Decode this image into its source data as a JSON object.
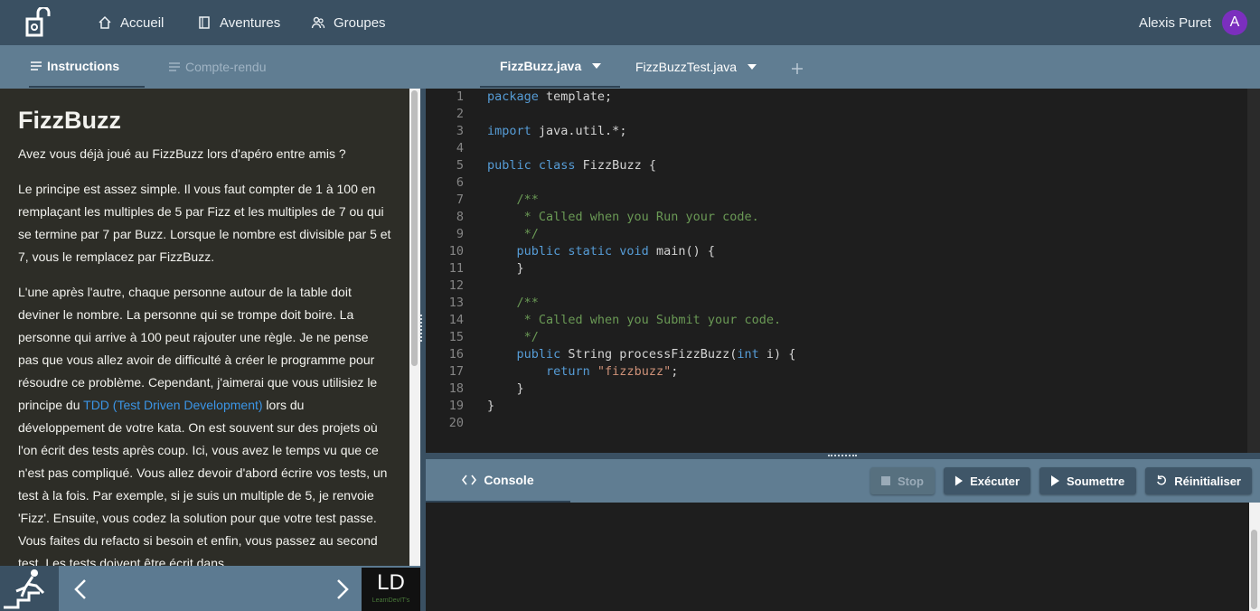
{
  "nav": {
    "home": "Accueil",
    "adventures": "Aventures",
    "groups": "Groupes"
  },
  "user": {
    "name": "Alexis Puret",
    "initial": "A"
  },
  "left_tabs": {
    "instructions": "Instructions",
    "report": "Compte-rendu"
  },
  "file_tabs": [
    "FizzBuzz.java",
    "FizzBuzzTest.java"
  ],
  "instructions": {
    "title": "FizzBuzz",
    "p1": "Avez vous déjà joué au FizzBuzz lors d'apéro entre amis ?",
    "p2": "Le principe est assez simple. Il vous faut compter de 1 à 100 en remplaçant les multiples de 5 par Fizz et les multiples de 7 ou qui se termine par 7 par Buzz. Lorsque le nombre est divisible par 5 et 7, vous le remplacez par FizzBuzz.",
    "p3_before": "L'une après l'autre, chaque personne autour de la table doit deviner le nombre. La personne qui se trompe doit boire. La personne qui arrive à 100 peut rajouter une règle. Je ne pense pas que vous allez avoir de difficulté à créer le programme pour résoudre ce problème. Cependant, j'aimerai que vous utilisiez le principe du ",
    "p3_link": "TDD (Test Driven Development)",
    "p3_after": " lors du développement de votre kata. On est souvent sur des projets où l'on écrit des tests après coup. Ici, vous avez le temps vu que ce n'est pas compliqué. Vous allez devoir d'abord écrire vos tests, un test à la fois. Par exemple, si je suis un multiple de 5, je renvoie 'Fizz'. Ensuite, vous codez la solution pour que votre test passe. Vous faites du refacto si besoin et enfin, vous passez au second test. Les tests doivent être écrit dans"
  },
  "logo_bottom": {
    "big": "LD",
    "small": "LearnDevIT's"
  },
  "editor": {
    "line_numbers": [
      "1",
      "2",
      "3",
      "4",
      "5",
      "6",
      "7",
      "8",
      "9",
      "10",
      "11",
      "12",
      "13",
      "14",
      "15",
      "16",
      "17",
      "18",
      "19",
      "20"
    ],
    "code": {
      "l1_kw": "package",
      "l1_rest": " template;",
      "l3_kw": "import",
      "l3_rest": " java.util.*;",
      "l5_kw": "public class",
      "l5_rest": " FizzBuzz {",
      "l7": "    /**",
      "l8": "     * Called when you Run your code.",
      "l9": "     */",
      "l10_kw": "    public static void",
      "l10_rest": " main() {",
      "l11": "    }",
      "l13": "    /**",
      "l14": "     * Called when you Submit your code.",
      "l15": "     */",
      "l16_kw": "    public",
      "l16_mid": " String processFizzBuzz(",
      "l16_kw2": "int",
      "l16_rest": " i) {",
      "l17_kw": "        return",
      "l17_str": " \"fizzbuzz\"",
      "l17_rest": ";",
      "l18": "    }",
      "l19": "}"
    }
  },
  "console": {
    "tab": "Console",
    "stop": "Stop",
    "run": "Exécuter",
    "submit": "Soumettre",
    "reset": "Réinitialiser"
  }
}
